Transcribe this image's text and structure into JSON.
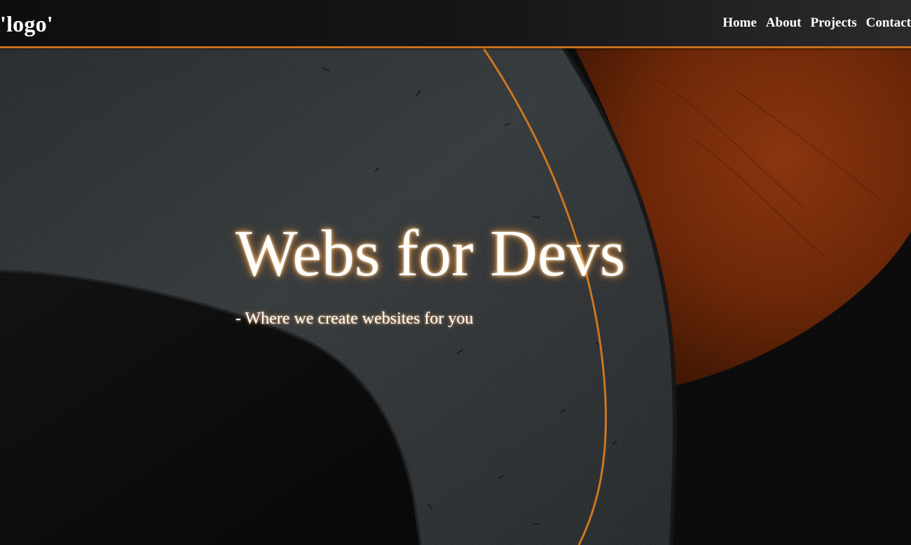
{
  "header": {
    "logo_text": "'logo'",
    "nav": {
      "home": "Home",
      "about": "About",
      "projects": "Projects",
      "contact": "Contact"
    }
  },
  "hero": {
    "title": "Webs for Devs",
    "subtitle": "- Where we create websites for you"
  },
  "colors": {
    "accent": "#c8701c",
    "orange_shape": "#7a2e0a",
    "grey_shape": "#2f3335",
    "background": "#0b0b0b",
    "text": "#ffffff"
  }
}
